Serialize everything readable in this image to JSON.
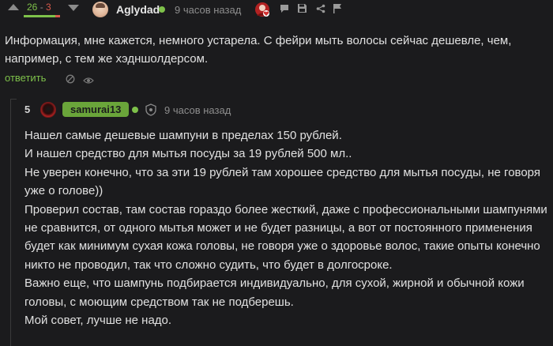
{
  "comment1": {
    "rating_plus": "26",
    "rating_sep": "-",
    "rating_minus": "3",
    "username": "Aglydad",
    "time": "9 часов назад",
    "lines": [
      "Информация, мне кажется, немного устарела. С фейри мыть волосы сейчас дешевле, чем,",
      "например, с тем же хэдншолдерсом."
    ],
    "reply_label": "ответить"
  },
  "comment2": {
    "vote": "5",
    "username": "samurai13",
    "time": "9 часов назад",
    "lines": [
      "Нашел самые дешевые шампуни в пределах 150 рублей.",
      "И нашел средство для мытья посуды за 19 рублей 500 мл..",
      "Не уверен конечно, что за эти 19 рублей там хорошее средство для мытья посуды, не говоря",
      "уже о голове))",
      "Проверил состав, там состав гораздо более жесткий, даже с профессиональными шампунями",
      "не сравнится, от одного мытья может и не будет разницы, а вот от постоянного применения",
      "будет как минимум сухая кожа головы, не говоря уже о здоровье волос, такие опыты конечно",
      "никто не проводил, так что сложно судить, что будет в долгосроке.",
      "Важно еще, что шампунь подбирается индивидуально, для сухой, жирной и обычной кожи",
      "головы, с моющим средством так не подберешь.",
      "Мой совет, лучше не надо."
    ]
  },
  "colors": {
    "background": "#1b1b1d",
    "positive": "#7ec14a",
    "negative": "#d85a4b",
    "user_badge": "#6aa53a"
  }
}
